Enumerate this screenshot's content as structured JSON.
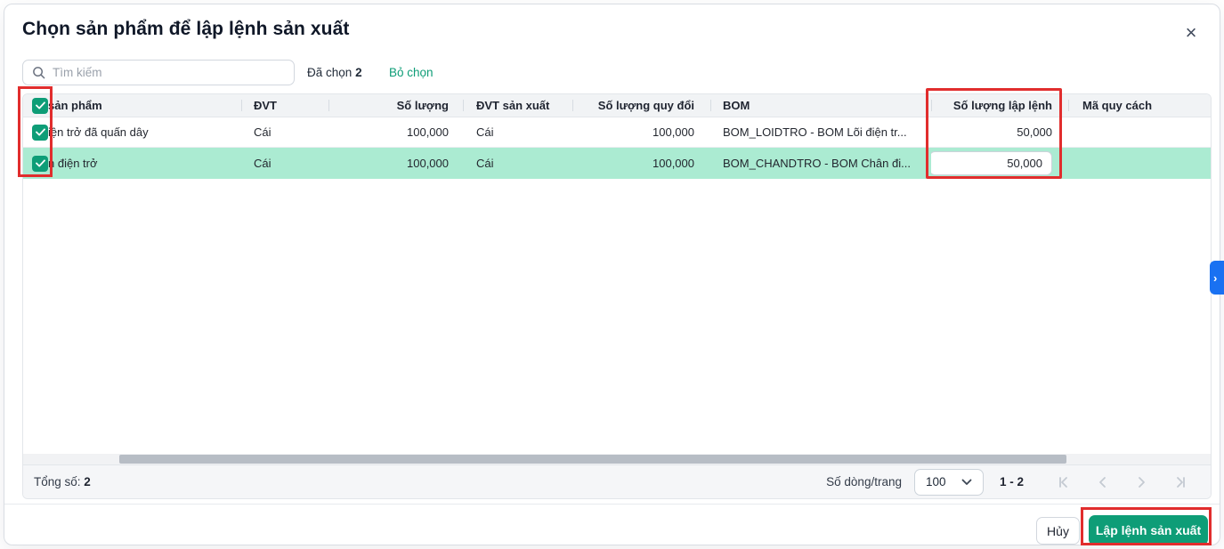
{
  "modal": {
    "title": "Chọn sản phẩm để lập lệnh sản xuất"
  },
  "icons": {
    "close": "×",
    "side_expand": "›"
  },
  "toolbar": {
    "search_placeholder": "Tìm kiếm",
    "selected_label": "Đã chọn",
    "selected_count": "2",
    "deselect_link": "Bỏ chọn"
  },
  "table": {
    "columns": [
      "sản phẩm",
      "ĐVT",
      "Số lượng",
      "ĐVT sản xuất",
      "Số lượng quy đổi",
      "BOM",
      "Số lượng lập lệnh",
      "Mã quy cách"
    ],
    "rows": [
      {
        "checked": true,
        "product": "iện trở đã quấn dây",
        "unit": "Cái",
        "quantity": "100,000",
        "production_unit": "Cái",
        "converted_quantity": "100,000",
        "bom": "BOM_LOIDTRO - BOM Lõi điện tr...",
        "order_quantity": "50,000",
        "spec_code": ""
      },
      {
        "checked": true,
        "product": "n điện trở",
        "unit": "Cái",
        "quantity": "100,000",
        "production_unit": "Cái",
        "converted_quantity": "100,000",
        "bom": "BOM_CHANDTRO - BOM Chân đi...",
        "order_quantity": "50,000",
        "spec_code": ""
      }
    ]
  },
  "pagination": {
    "total_label": "Tổng số:",
    "total_value": "2",
    "rows_per_page_label": "Số dòng/trang",
    "rows_per_page_value": "100",
    "page_range": "1 - 2"
  },
  "actions": {
    "cancel": "Hủy",
    "submit": "Lập lệnh sản xuất"
  },
  "colors": {
    "accent_teal": "#0e9d77",
    "row_highlight": "#abebd2",
    "annotation_red": "#e12d2d",
    "side_button_blue": "#1971f2"
  }
}
